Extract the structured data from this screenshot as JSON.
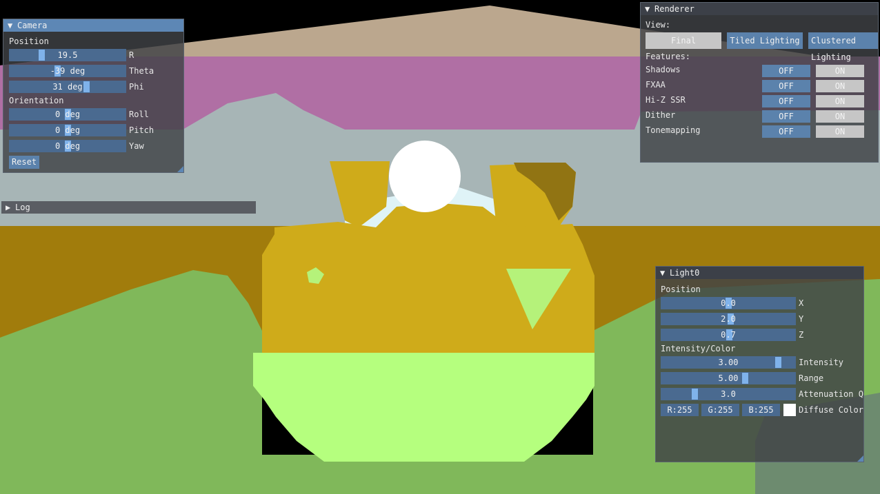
{
  "camera": {
    "title": "Camera",
    "position_label": "Position",
    "r": {
      "value": "19.5",
      "label": "R",
      "fraction": 0.27
    },
    "theta": {
      "value": "-39 deg",
      "label": "Theta",
      "fraction": 0.41
    },
    "phi": {
      "value": "31 deg",
      "label": "Phi",
      "fraction": 0.67
    },
    "orientation_label": "Orientation",
    "roll": {
      "value": "0 deg",
      "label": "Roll",
      "fraction": 0.5
    },
    "pitch": {
      "value": "0 deg",
      "label": "Pitch",
      "fraction": 0.5
    },
    "yaw": {
      "value": "0 deg",
      "label": "Yaw",
      "fraction": 0.5
    },
    "reset_label": "Reset"
  },
  "log": {
    "title": "Log"
  },
  "renderer": {
    "title": "Renderer",
    "view_label": "View:",
    "views": [
      "Final",
      "Tiled Lighting",
      "Clustered Lighting"
    ],
    "features_label": "Features:",
    "off_label": "OFF",
    "on_label": "ON",
    "features": [
      {
        "name": "Shadows",
        "state": "OFF"
      },
      {
        "name": "FXAA",
        "state": "OFF"
      },
      {
        "name": "Hi-Z SSR",
        "state": "OFF"
      },
      {
        "name": "Dither",
        "state": "OFF"
      },
      {
        "name": "Tonemapping",
        "state": "OFF"
      }
    ]
  },
  "light0": {
    "title": "Light0",
    "position_label": "Position",
    "x": {
      "value": "0.0",
      "label": "X",
      "fraction": 0.5
    },
    "y": {
      "value": "2.0",
      "label": "Y",
      "fraction": 0.52
    },
    "z": {
      "value": "0.7",
      "label": "Z",
      "fraction": 0.51
    },
    "intensity_color_label": "Intensity/Color",
    "intensity": {
      "value": "3.00",
      "label": "Intensity",
      "fraction": 0.89
    },
    "range": {
      "value": "5.00",
      "label": "Range",
      "fraction": 0.63
    },
    "attenuation": {
      "value": "3.0",
      "label": "Attenuation Q",
      "fraction": 0.24
    },
    "r_label": "R:255",
    "g_label": "G:255",
    "b_label": "B:255",
    "diffuse_label": "Diffuse Color",
    "diffuse_color": "#ffffff"
  }
}
